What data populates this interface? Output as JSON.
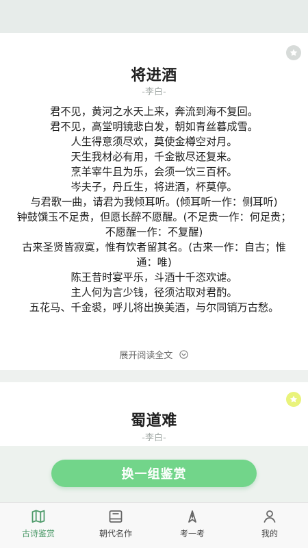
{
  "colors": {
    "accent": "#72d58a",
    "active_nav": "#4f9b6b",
    "star_inactive": "#d7dbd9",
    "star_active": "#e9f37b"
  },
  "cards": [
    {
      "title": "将进酒",
      "author": "-李白-",
      "lines": [
        "君不见，黄河之水天上来，奔流到海不复回。",
        "君不见，高堂明镜悲白发，朝如青丝暮成雪。",
        "人生得意须尽欢，莫使金樽空对月。",
        "天生我材必有用，千金散尽还复来。",
        "烹羊宰牛且为乐，会须一饮三百杯。",
        "岑夫子，丹丘生，将进酒，杯莫停。",
        "与君歌一曲，请君为我倾耳听。(倾耳听一作：侧耳听)",
        "钟鼓馔玉不足贵，但愿长醉不愿醒。(不足贵一作：何足贵；不愿醒一作：不复醒)",
        "古来圣贤皆寂寞，惟有饮者留其名。(古来一作：自古；惟通：唯)",
        "陈王昔时宴平乐，斗酒十千恣欢谑。",
        "主人何为言少钱，径须沽取对君酌。",
        "五花马、千金裘，呼儿将出换美酒，与尔同销万古愁。"
      ],
      "read_more": "展开阅读全文",
      "star_icon": "star-icon"
    },
    {
      "title": "蜀道难",
      "author": "-李白-",
      "star_icon": "star-icon"
    }
  ],
  "actions": {
    "swap_label": "换一组鉴赏"
  },
  "nav": {
    "items": [
      {
        "label": "古诗鉴赏",
        "icon": "book-map-icon",
        "active": true
      },
      {
        "label": "朝代名作",
        "icon": "window-icon",
        "active": false
      },
      {
        "label": "考一考",
        "icon": "pen-nib-icon",
        "active": false
      },
      {
        "label": "我的",
        "icon": "user-icon",
        "active": false
      }
    ]
  }
}
